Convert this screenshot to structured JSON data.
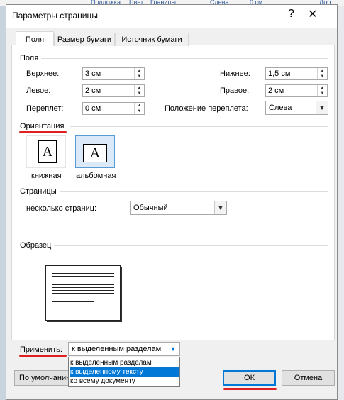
{
  "background": {
    "items": [
      "Подложка",
      "Цвет",
      "Границы",
      "Слева",
      "0 см",
      "Доб"
    ]
  },
  "dialog": {
    "title": "Параметры страницы",
    "help": "?",
    "close": "✕"
  },
  "tabs": [
    {
      "label": "Поля",
      "active": true
    },
    {
      "label": "Размер бумаги",
      "active": false
    },
    {
      "label": "Источник бумаги",
      "active": false
    }
  ],
  "margins": {
    "group": "Поля",
    "top": {
      "label": "Верхнее:",
      "value": "3 см"
    },
    "bottom": {
      "label": "Нижнее:",
      "value": "1,5 см"
    },
    "left": {
      "label": "Левое:",
      "value": "2 см"
    },
    "right": {
      "label": "Правое:",
      "value": "2 см"
    },
    "gutter": {
      "label": "Переплет:",
      "value": "0 см"
    },
    "gutter_pos": {
      "label": "Положение переплета:",
      "value": "Слева"
    }
  },
  "orientation": {
    "group": "Ориентация",
    "portrait": "книжная",
    "landscape": "альбомная",
    "glyph": "A"
  },
  "pages": {
    "group": "Страницы",
    "multiple_label": "несколько страниц:",
    "multiple_value": "Обычный"
  },
  "preview": {
    "group": "Образец"
  },
  "apply": {
    "label": "Применить:",
    "value": "к выделенным разделам",
    "options": [
      "к выделенным разделам",
      "к выделенному тексту",
      "ко всему документу"
    ],
    "selected_index": 1
  },
  "buttons": {
    "default": "По умолчанию",
    "ok": "ОК",
    "cancel": "Отмена"
  },
  "colors": {
    "accent": "#0078d7",
    "annotation": "#e02020"
  }
}
